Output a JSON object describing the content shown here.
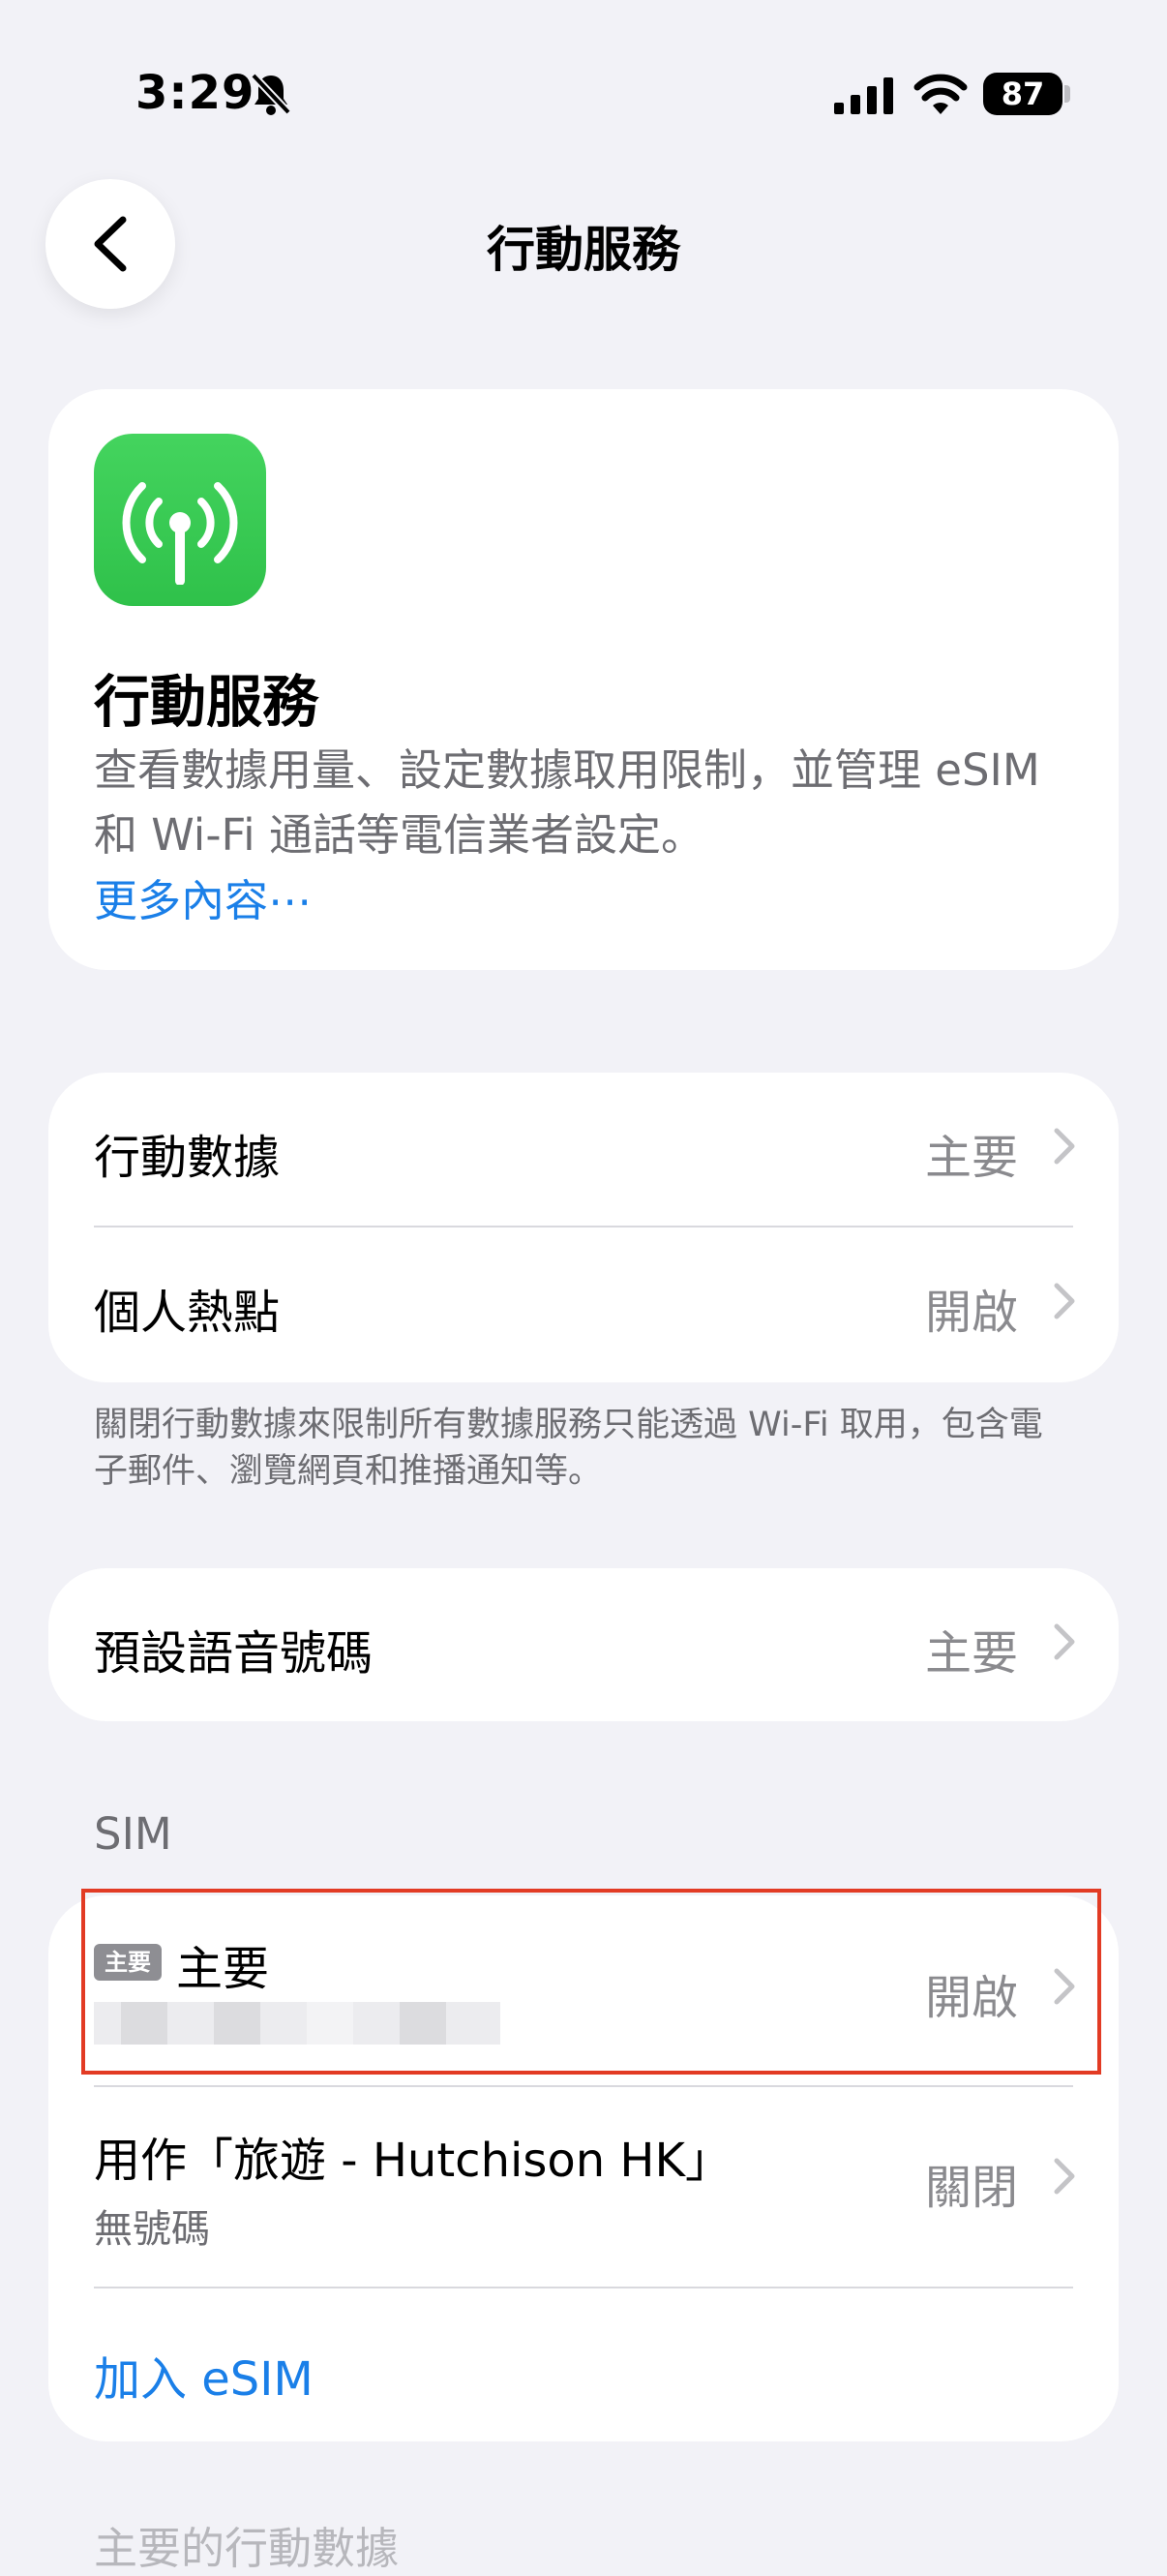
{
  "status_bar": {
    "time": "3:29",
    "battery": "87"
  },
  "nav": {
    "title": "行動服務"
  },
  "intro": {
    "title": "行動服務",
    "description": "查看數據用量、設定數據取用限制，並管理 eSIM 和 Wi-Fi 通話等電信業者設定。",
    "more_link": "更多內容⋯"
  },
  "group1": {
    "rows": [
      {
        "label": "行動數據",
        "value": "主要"
      },
      {
        "label": "個人熱點",
        "value": "開啟"
      }
    ],
    "footnote": "關閉行動數據來限制所有數據服務只能透過 Wi-Fi 取用，包含電子郵件、瀏覽網頁和推播通知等。"
  },
  "group2": {
    "rows": [
      {
        "label": "預設語音號碼",
        "value": "主要"
      }
    ]
  },
  "sim": {
    "header": "SIM",
    "primary": {
      "badge": "主要",
      "name": "主要",
      "value": "開啟"
    },
    "travel": {
      "label": "用作「旅遊 - Hutchison HK」",
      "sublabel": "無號碼",
      "value": "關閉"
    },
    "add_esim": "加入 eSIM"
  },
  "bottom_partial": "主要的行動數據"
}
